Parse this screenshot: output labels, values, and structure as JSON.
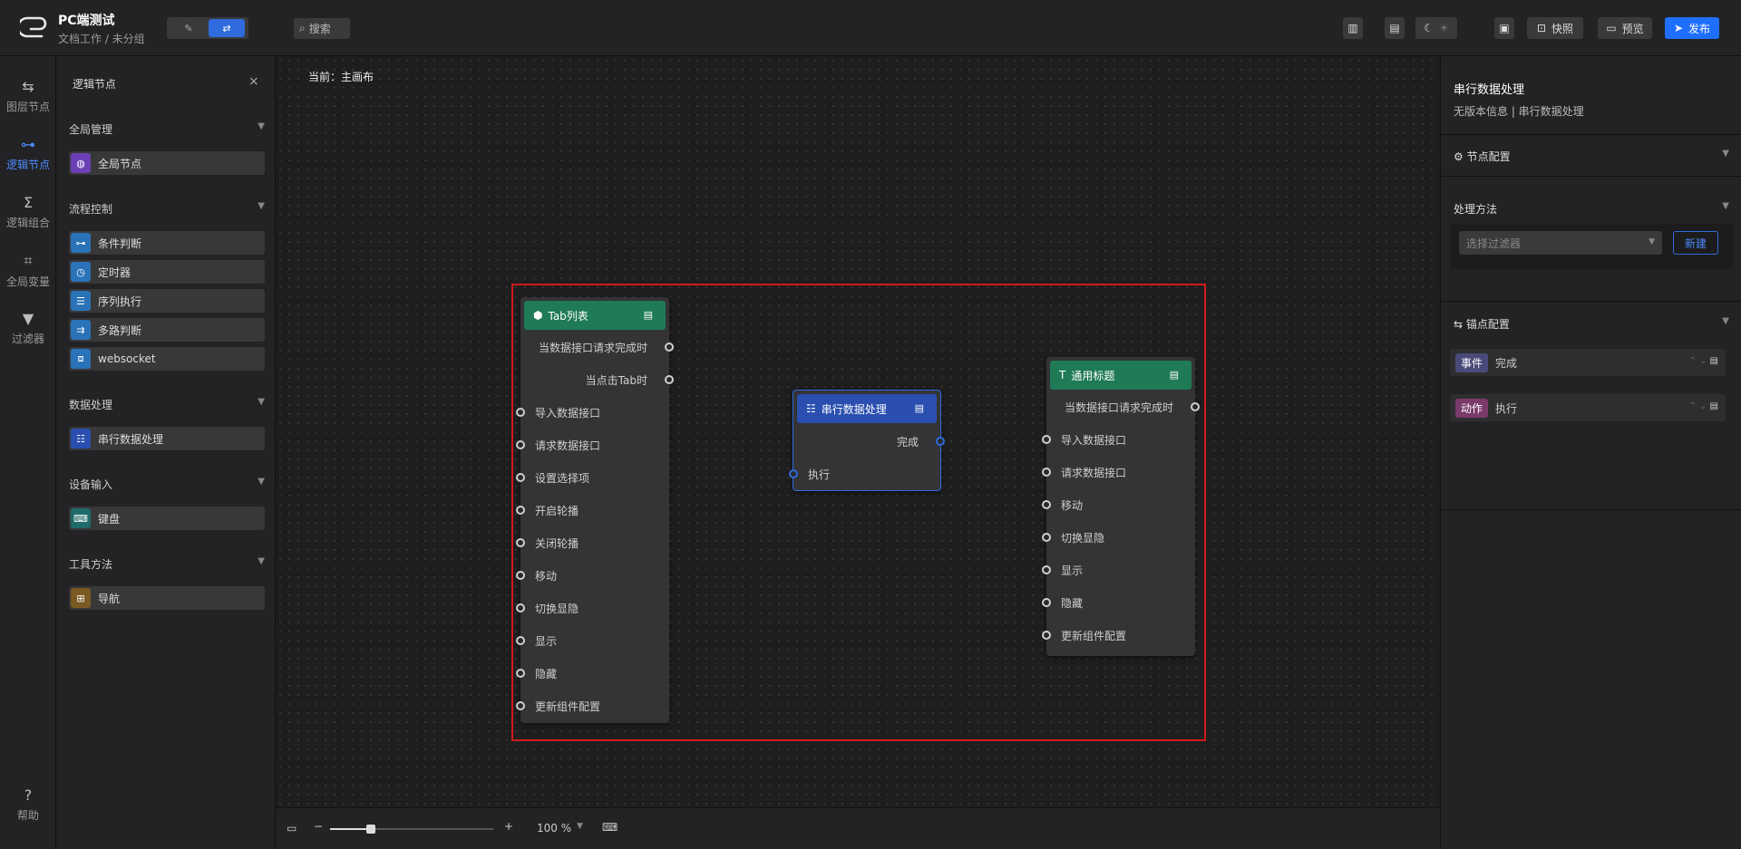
{
  "header": {
    "app_title": "PC端测试",
    "app_subtitle": "文档工作 / 未分组",
    "search_label": "搜索",
    "snapshot_label": "快照",
    "preview_label": "预览",
    "publish_label": "发布"
  },
  "iconbar": {
    "items": [
      {
        "label": "图层节点",
        "icon": "layers-icon"
      },
      {
        "label": "逻辑节点",
        "icon": "logic-node-icon"
      },
      {
        "label": "逻辑组合",
        "icon": "sigma-icon"
      },
      {
        "label": "全局变量",
        "icon": "variable-icon"
      },
      {
        "label": "过滤器",
        "icon": "filter-icon"
      }
    ],
    "help_label": "帮助"
  },
  "panel": {
    "title": "逻辑节点",
    "groups": [
      {
        "title": "全局管理",
        "items": [
          {
            "label": "全局节点",
            "color": "#6b3fb5"
          }
        ]
      },
      {
        "title": "流程控制",
        "items": [
          {
            "label": "条件判断",
            "color": "#2a73b8"
          },
          {
            "label": "定时器",
            "color": "#2a73b8"
          },
          {
            "label": "序列执行",
            "color": "#2a73b8"
          },
          {
            "label": "多路判断",
            "color": "#2a73b8"
          },
          {
            "label": "websocket",
            "color": "#2a73b8"
          }
        ]
      },
      {
        "title": "数据处理",
        "items": [
          {
            "label": "串行数据处理",
            "color": "#2a4fb0"
          }
        ]
      },
      {
        "title": "设备输入",
        "items": [
          {
            "label": "键盘",
            "color": "#1f6a6a"
          }
        ]
      },
      {
        "title": "工具方法",
        "items": [
          {
            "label": "导航",
            "color": "#7a5a22"
          }
        ]
      }
    ]
  },
  "canvas": {
    "crumb": "当前：主画布",
    "nodes": {
      "tab_list": {
        "title": "Tab列表",
        "outputs": [
          "当数据接口请求完成时",
          "当点击Tab时"
        ],
        "inputs": [
          "导入数据接口",
          "请求数据接口",
          "设置选择项",
          "开启轮播",
          "关闭轮播",
          "移动",
          "切换显隐",
          "显示",
          "隐藏",
          "更新组件配置"
        ]
      },
      "serial": {
        "title": "串行数据处理",
        "outputs": [
          "完成"
        ],
        "inputs": [
          "执行"
        ]
      },
      "general_title": {
        "title": "通用标题",
        "outputs": [
          "当数据接口请求完成时"
        ],
        "inputs": [
          "导入数据接口",
          "请求数据接口",
          "移动",
          "切换显隐",
          "显示",
          "隐藏",
          "更新组件配置"
        ]
      }
    }
  },
  "bottombar": {
    "zoom": "100 %",
    "zoom_level": 0.25
  },
  "rpanel": {
    "title": "串行数据处理",
    "subtitle": "无版本信息 | 串行数据处理",
    "node_config": "节点配置",
    "method": "处理方法",
    "select_placeholder": "选择过滤器",
    "new_button": "新建",
    "anchor_config": "锚点配置",
    "anchors": [
      {
        "tag": "事件",
        "label": "完成",
        "color": "#4a4a7a"
      },
      {
        "tag": "动作",
        "label": "执行",
        "color": "#7a3a6a"
      }
    ]
  }
}
